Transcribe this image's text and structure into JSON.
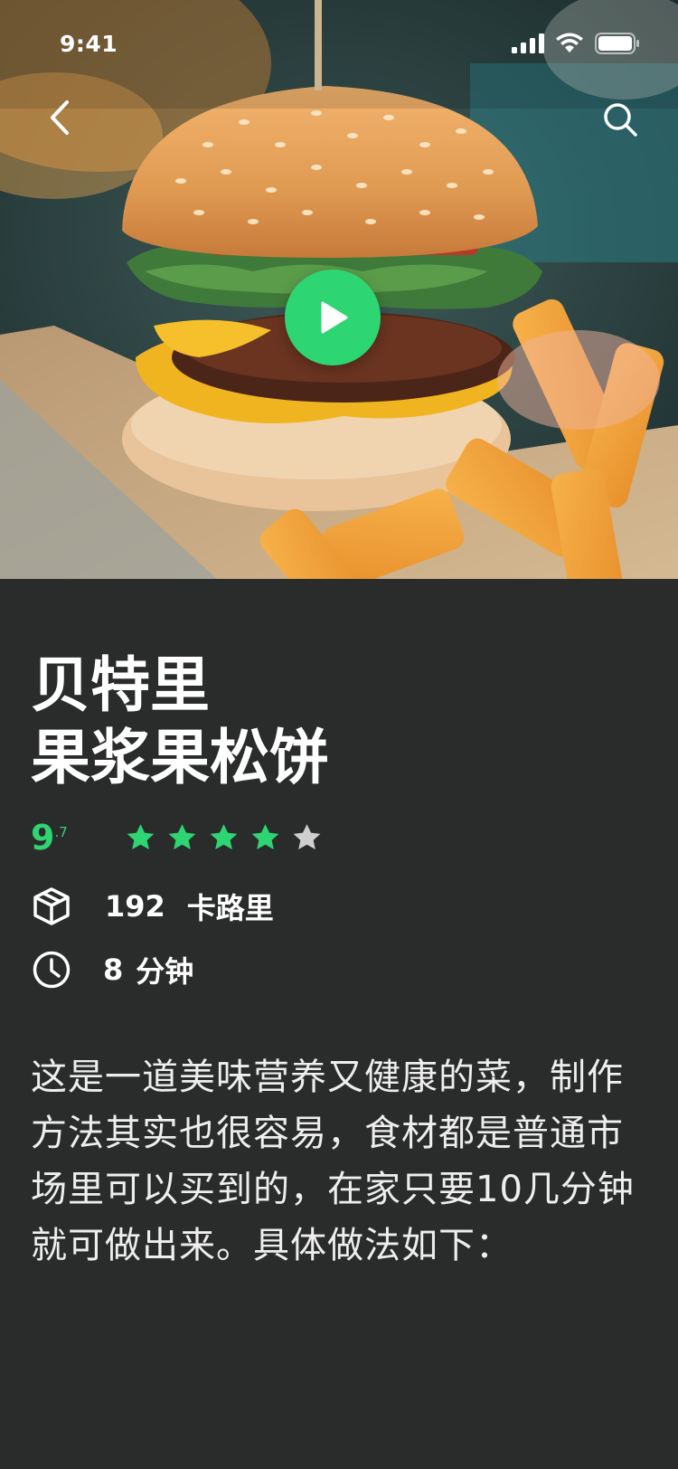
{
  "status_bar": {
    "time": "9:41"
  },
  "hero": {
    "icons": {
      "back": "chevron-left-icon",
      "search": "search-icon",
      "play": "play-icon"
    },
    "accent_color": "#2ed573"
  },
  "recipe": {
    "title_line1": "贝特里",
    "title_line2": "果浆果松饼",
    "rating": {
      "score_main": "9",
      "score_sub": ".7",
      "stars_filled": 4,
      "stars_total": 5,
      "filled_color": "#2ed573",
      "empty_color": "#cfcfcf"
    },
    "calories": {
      "icon": "package-icon",
      "value": "192",
      "unit": "卡路里"
    },
    "time": {
      "icon": "clock-icon",
      "value": "8",
      "unit": "分钟"
    },
    "description": "这是一道美味营养又健康的菜，制作方法其实也很容易，食材都是普通市场里可以买到的，在家只要10几分钟就可做出来。具体做法如下："
  },
  "colors": {
    "background": "#2a2c2b",
    "accent": "#2ed573",
    "text": "#ffffff"
  }
}
